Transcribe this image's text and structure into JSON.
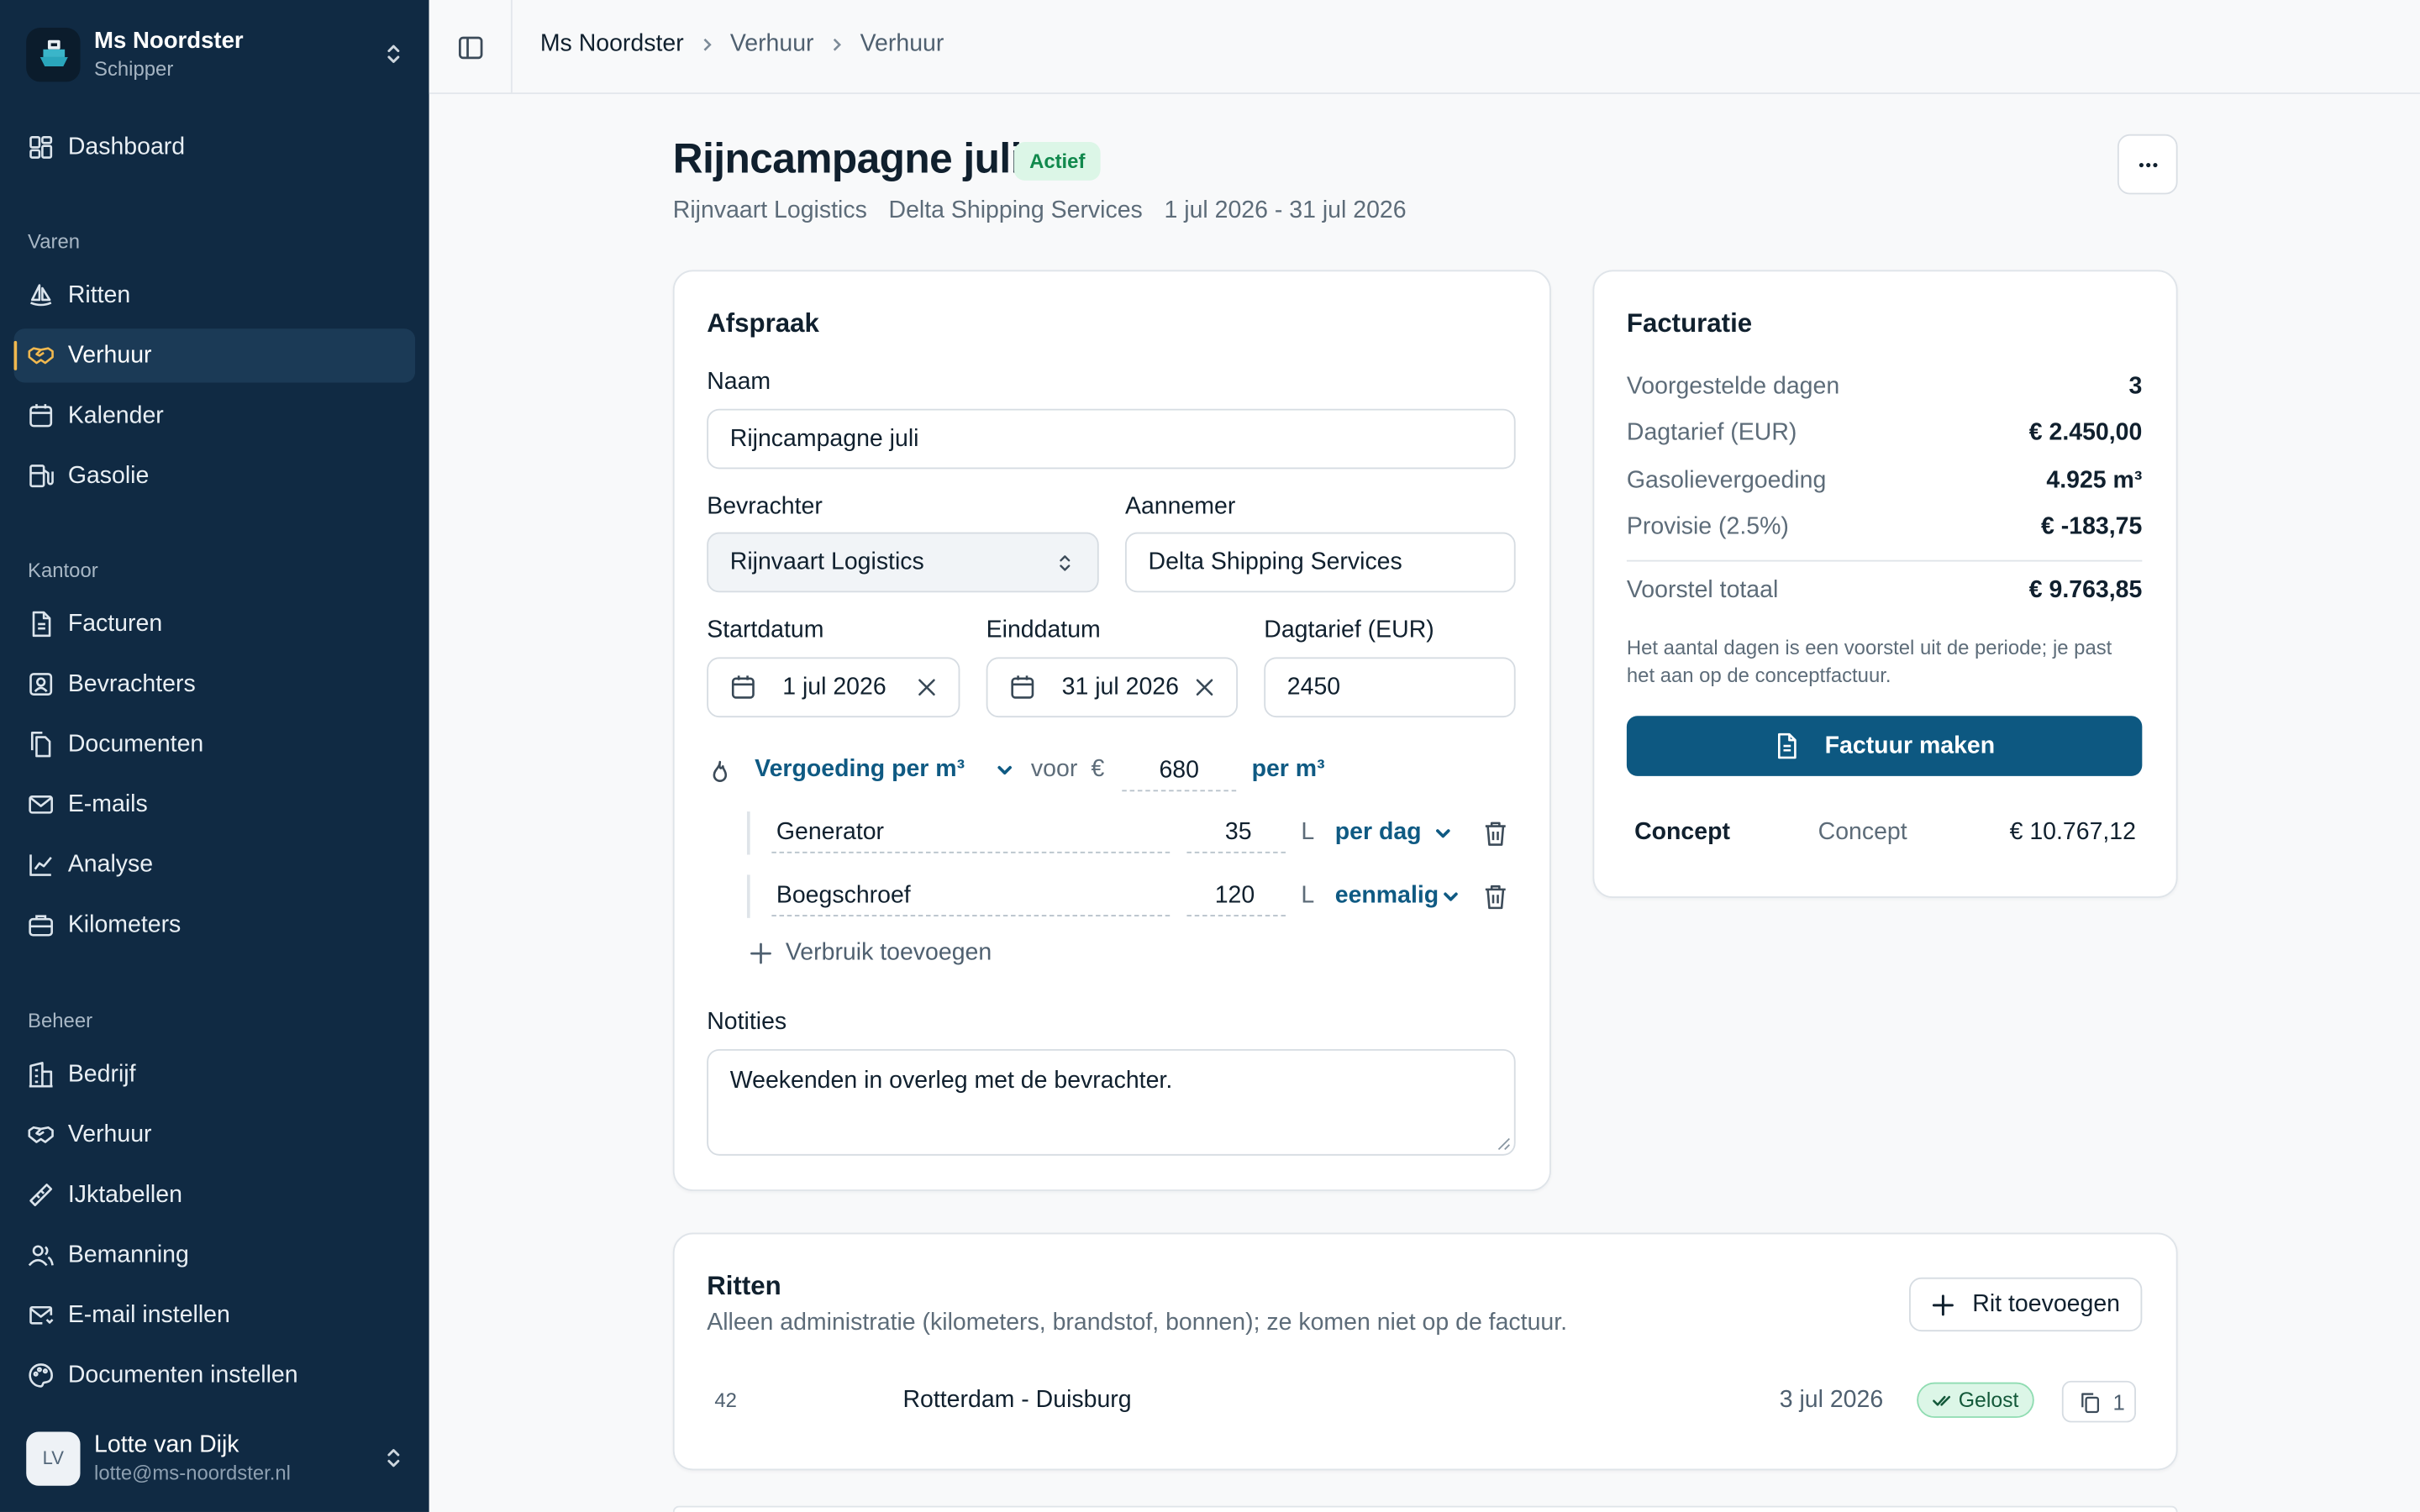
{
  "org": {
    "name": "Ms Noordster",
    "role": "Schipper"
  },
  "nav": {
    "dashboard": "Dashboard",
    "group_varen": "Varen",
    "ritten": "Ritten",
    "verhuur": "Verhuur",
    "kalender": "Kalender",
    "gasolie": "Gasolie",
    "group_kantoor": "Kantoor",
    "facturen": "Facturen",
    "bevrachters": "Bevrachters",
    "documenten": "Documenten",
    "emails": "E-mails",
    "analyse": "Analyse",
    "kilometers": "Kilometers",
    "group_beheer": "Beheer",
    "bedrijf": "Bedrijf",
    "verhuur2": "Verhuur",
    "ijktabellen": "IJktabellen",
    "bemanning": "Bemanning",
    "email_instellen": "E-mail instellen",
    "documenten_instellen": "Documenten instellen"
  },
  "user": {
    "initials": "LV",
    "name": "Lotte van Dijk",
    "email": "lotte@ms-noordster.nl"
  },
  "breadcrumb": [
    "Ms Noordster",
    "Verhuur",
    "Verhuur"
  ],
  "header": {
    "title": "Rijncampagne juli",
    "status": "Actief",
    "charterer": "Rijnvaart Logistics",
    "contractor": "Delta Shipping Services",
    "period": "1 jul 2026 - 31 jul 2026"
  },
  "agreement": {
    "title": "Afspraak",
    "name_label": "Naam",
    "name_value": "Rijncampagne juli",
    "charterer_label": "Bevrachter",
    "charterer_value": "Rijnvaart Logistics",
    "contractor_label": "Aannemer",
    "contractor_value": "Delta Shipping Services",
    "start_label": "Startdatum",
    "start_value": "1 jul 2026",
    "end_label": "Einddatum",
    "end_value": "31 jul 2026",
    "rate_label": "Dagtarief (EUR)",
    "rate_value": "2450",
    "comp_mode": "Vergoeding per m³",
    "comp_for": "voor",
    "comp_currency": "€",
    "comp_value": "680",
    "comp_unit": "per m³",
    "consumption": [
      {
        "name": "Generator",
        "amount": "35",
        "unit": "L",
        "freq": "per dag"
      },
      {
        "name": "Boegschroef",
        "amount": "120",
        "unit": "L",
        "freq": "eenmalig"
      }
    ],
    "add_consumption": "Verbruik toevoegen",
    "notes_label": "Notities",
    "notes_value": "Weekenden in overleg met de bevrachter."
  },
  "billing": {
    "title": "Facturatie",
    "rows": [
      {
        "label": "Voorgestelde dagen",
        "value": "3"
      },
      {
        "label": "Dagtarief (EUR)",
        "value": "€ 2.450,00"
      },
      {
        "label": "Gasolievergoeding",
        "value": "4.925 m³"
      },
      {
        "label": "Provisie (2.5%)",
        "value": "€ -183,75"
      }
    ],
    "total_label": "Voorstel totaal",
    "total_value": "€ 9.763,85",
    "note": "Het aantal dagen is een voorstel uit de periode; je past het aan op de conceptfactuur.",
    "button": "Factuur maken",
    "invoice_name": "Concept",
    "invoice_status": "Concept",
    "invoice_amount": "€ 10.767,12"
  },
  "trips": {
    "title": "Ritten",
    "subtitle": "Alleen administratie (kilometers, brandstof, bonnen); ze komen niet op de factuur.",
    "add_button": "Rit toevoegen",
    "rows": [
      {
        "number": "42",
        "route": "Rotterdam - Duisburg",
        "date": "3 jul 2026",
        "status": "Gelost",
        "docs": "1"
      }
    ]
  },
  "colors": {
    "sidebar": "#102a43",
    "accent": "#0d5881",
    "active_icon": "#f0b84f",
    "success_bg": "#dcf6e7"
  }
}
